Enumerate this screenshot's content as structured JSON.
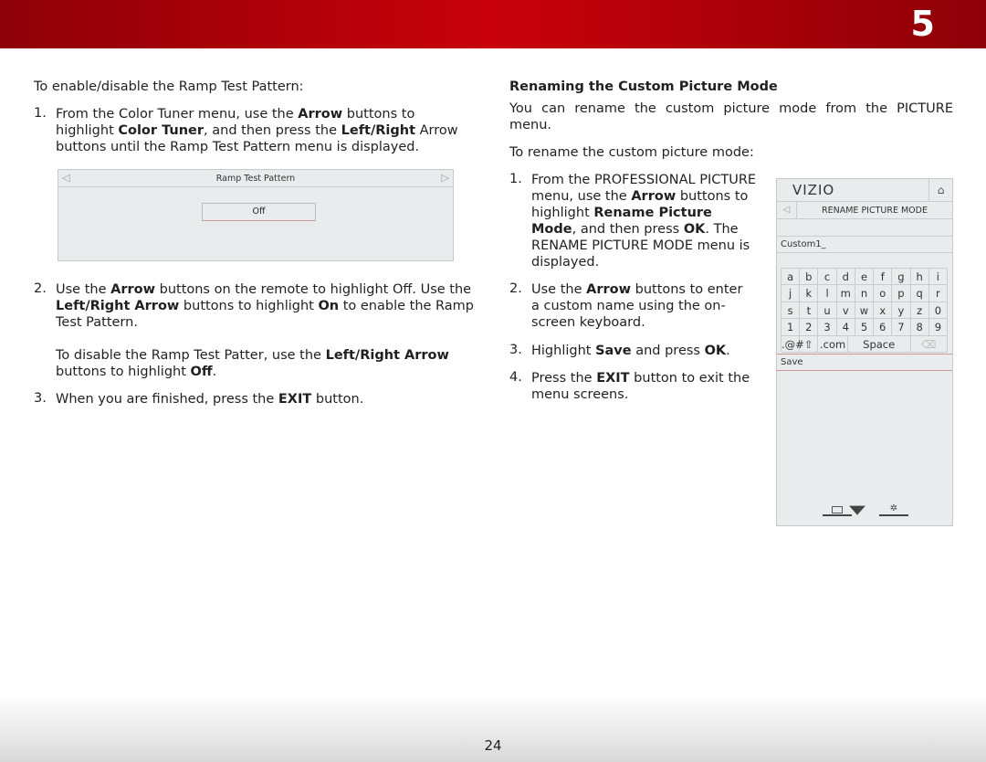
{
  "header": {
    "chapter": "5",
    "color": "#c8000b"
  },
  "footer": {
    "page": "24"
  },
  "left": {
    "intro": [
      {
        "t": "To enable/disable the Ramp Test Pattern:"
      }
    ],
    "steps": [
      {
        "n": "1.",
        "text": [
          {
            "t": "From the Color Tuner menu, use the "
          },
          {
            "t": "Arrow",
            "b": 1
          },
          {
            "t": " buttons to highlight "
          },
          {
            "t": "Color Tuner",
            "b": 1
          },
          {
            "t": ", and then press the "
          },
          {
            "t": "Left/Right",
            "b": 1
          },
          {
            "t": " Arrow buttons until the Ramp Test Pattern menu is displayed."
          }
        ]
      },
      {
        "n": "2.",
        "text": [
          {
            "t": "Use the "
          },
          {
            "t": "Arrow",
            "b": 1
          },
          {
            "t": " buttons on the remote to highlight Off. Use the "
          },
          {
            "t": "Left/Right Arrow",
            "b": 1
          },
          {
            "t": " buttons to highlight "
          },
          {
            "t": "On",
            "b": 1
          },
          {
            "t": " to enable the Ramp Test Pattern."
          }
        ]
      },
      {
        "n": "",
        "text": [
          {
            "t": "To disable the Ramp Test Patter, use the "
          },
          {
            "t": "Left/Right Arrow",
            "b": 1
          },
          {
            "t": " buttons to highlight "
          },
          {
            "t": "Off",
            "b": 1
          },
          {
            "t": "."
          }
        ]
      },
      {
        "n": "3.",
        "text": [
          {
            "t": "When you are finished, press the "
          },
          {
            "t": "EXIT",
            "b": 1
          },
          {
            "t": " button."
          }
        ]
      }
    ],
    "ramp_menu": {
      "title": "Ramp Test Pattern",
      "value": "Off"
    }
  },
  "right": {
    "heading": "Renaming the Custom Picture Mode",
    "p1": [
      {
        "t": "You can rename the custom picture mode from the PICTURE menu."
      }
    ],
    "p2": [
      {
        "t": "To rename the custom picture mode:"
      }
    ],
    "steps": [
      {
        "n": "1.",
        "text": [
          {
            "t": "From the PROFESSIONAL PICTURE menu, use the "
          },
          {
            "t": "Arrow",
            "b": 1
          },
          {
            "t": " buttons to highlight "
          },
          {
            "t": "Rename Picture Mode",
            "b": 1
          },
          {
            "t": ", and then press "
          },
          {
            "t": "OK",
            "b": 1
          },
          {
            "t": ". The RENAME PICTURE MODE menu is displayed."
          }
        ]
      },
      {
        "n": "2.",
        "text": [
          {
            "t": "Use the "
          },
          {
            "t": "Arrow",
            "b": 1
          },
          {
            "t": " buttons to enter a custom name using the on-screen keyboard."
          }
        ]
      },
      {
        "n": "3.",
        "text": [
          {
            "t": "Highlight "
          },
          {
            "t": "Save",
            "b": 1
          },
          {
            "t": " and press "
          },
          {
            "t": "OK",
            "b": 1
          },
          {
            "t": "."
          }
        ]
      },
      {
        "n": "4.",
        "text": [
          {
            "t": "Press the "
          },
          {
            "t": "EXIT",
            "b": 1
          },
          {
            "t": " button to exit the menu screens."
          }
        ]
      }
    ],
    "tv": {
      "logo": "VIZIO",
      "title": "RENAME PICTURE MODE",
      "input": "Custom1_",
      "keys": [
        [
          "a",
          "b",
          "c",
          "d",
          "e",
          "f",
          "g",
          "h",
          "i"
        ],
        [
          "j",
          "k",
          "l",
          "m",
          "n",
          "o",
          "p",
          "q",
          "r"
        ],
        [
          "s",
          "t",
          "u",
          "v",
          "w",
          "x",
          "y",
          "z",
          "0"
        ],
        [
          "1",
          "2",
          "3",
          "4",
          "5",
          "6",
          "7",
          "8",
          "9"
        ]
      ],
      "special": [
        ".@#",
        "⇧",
        ".com",
        "Space",
        "⌫"
      ],
      "save": "Save"
    }
  }
}
